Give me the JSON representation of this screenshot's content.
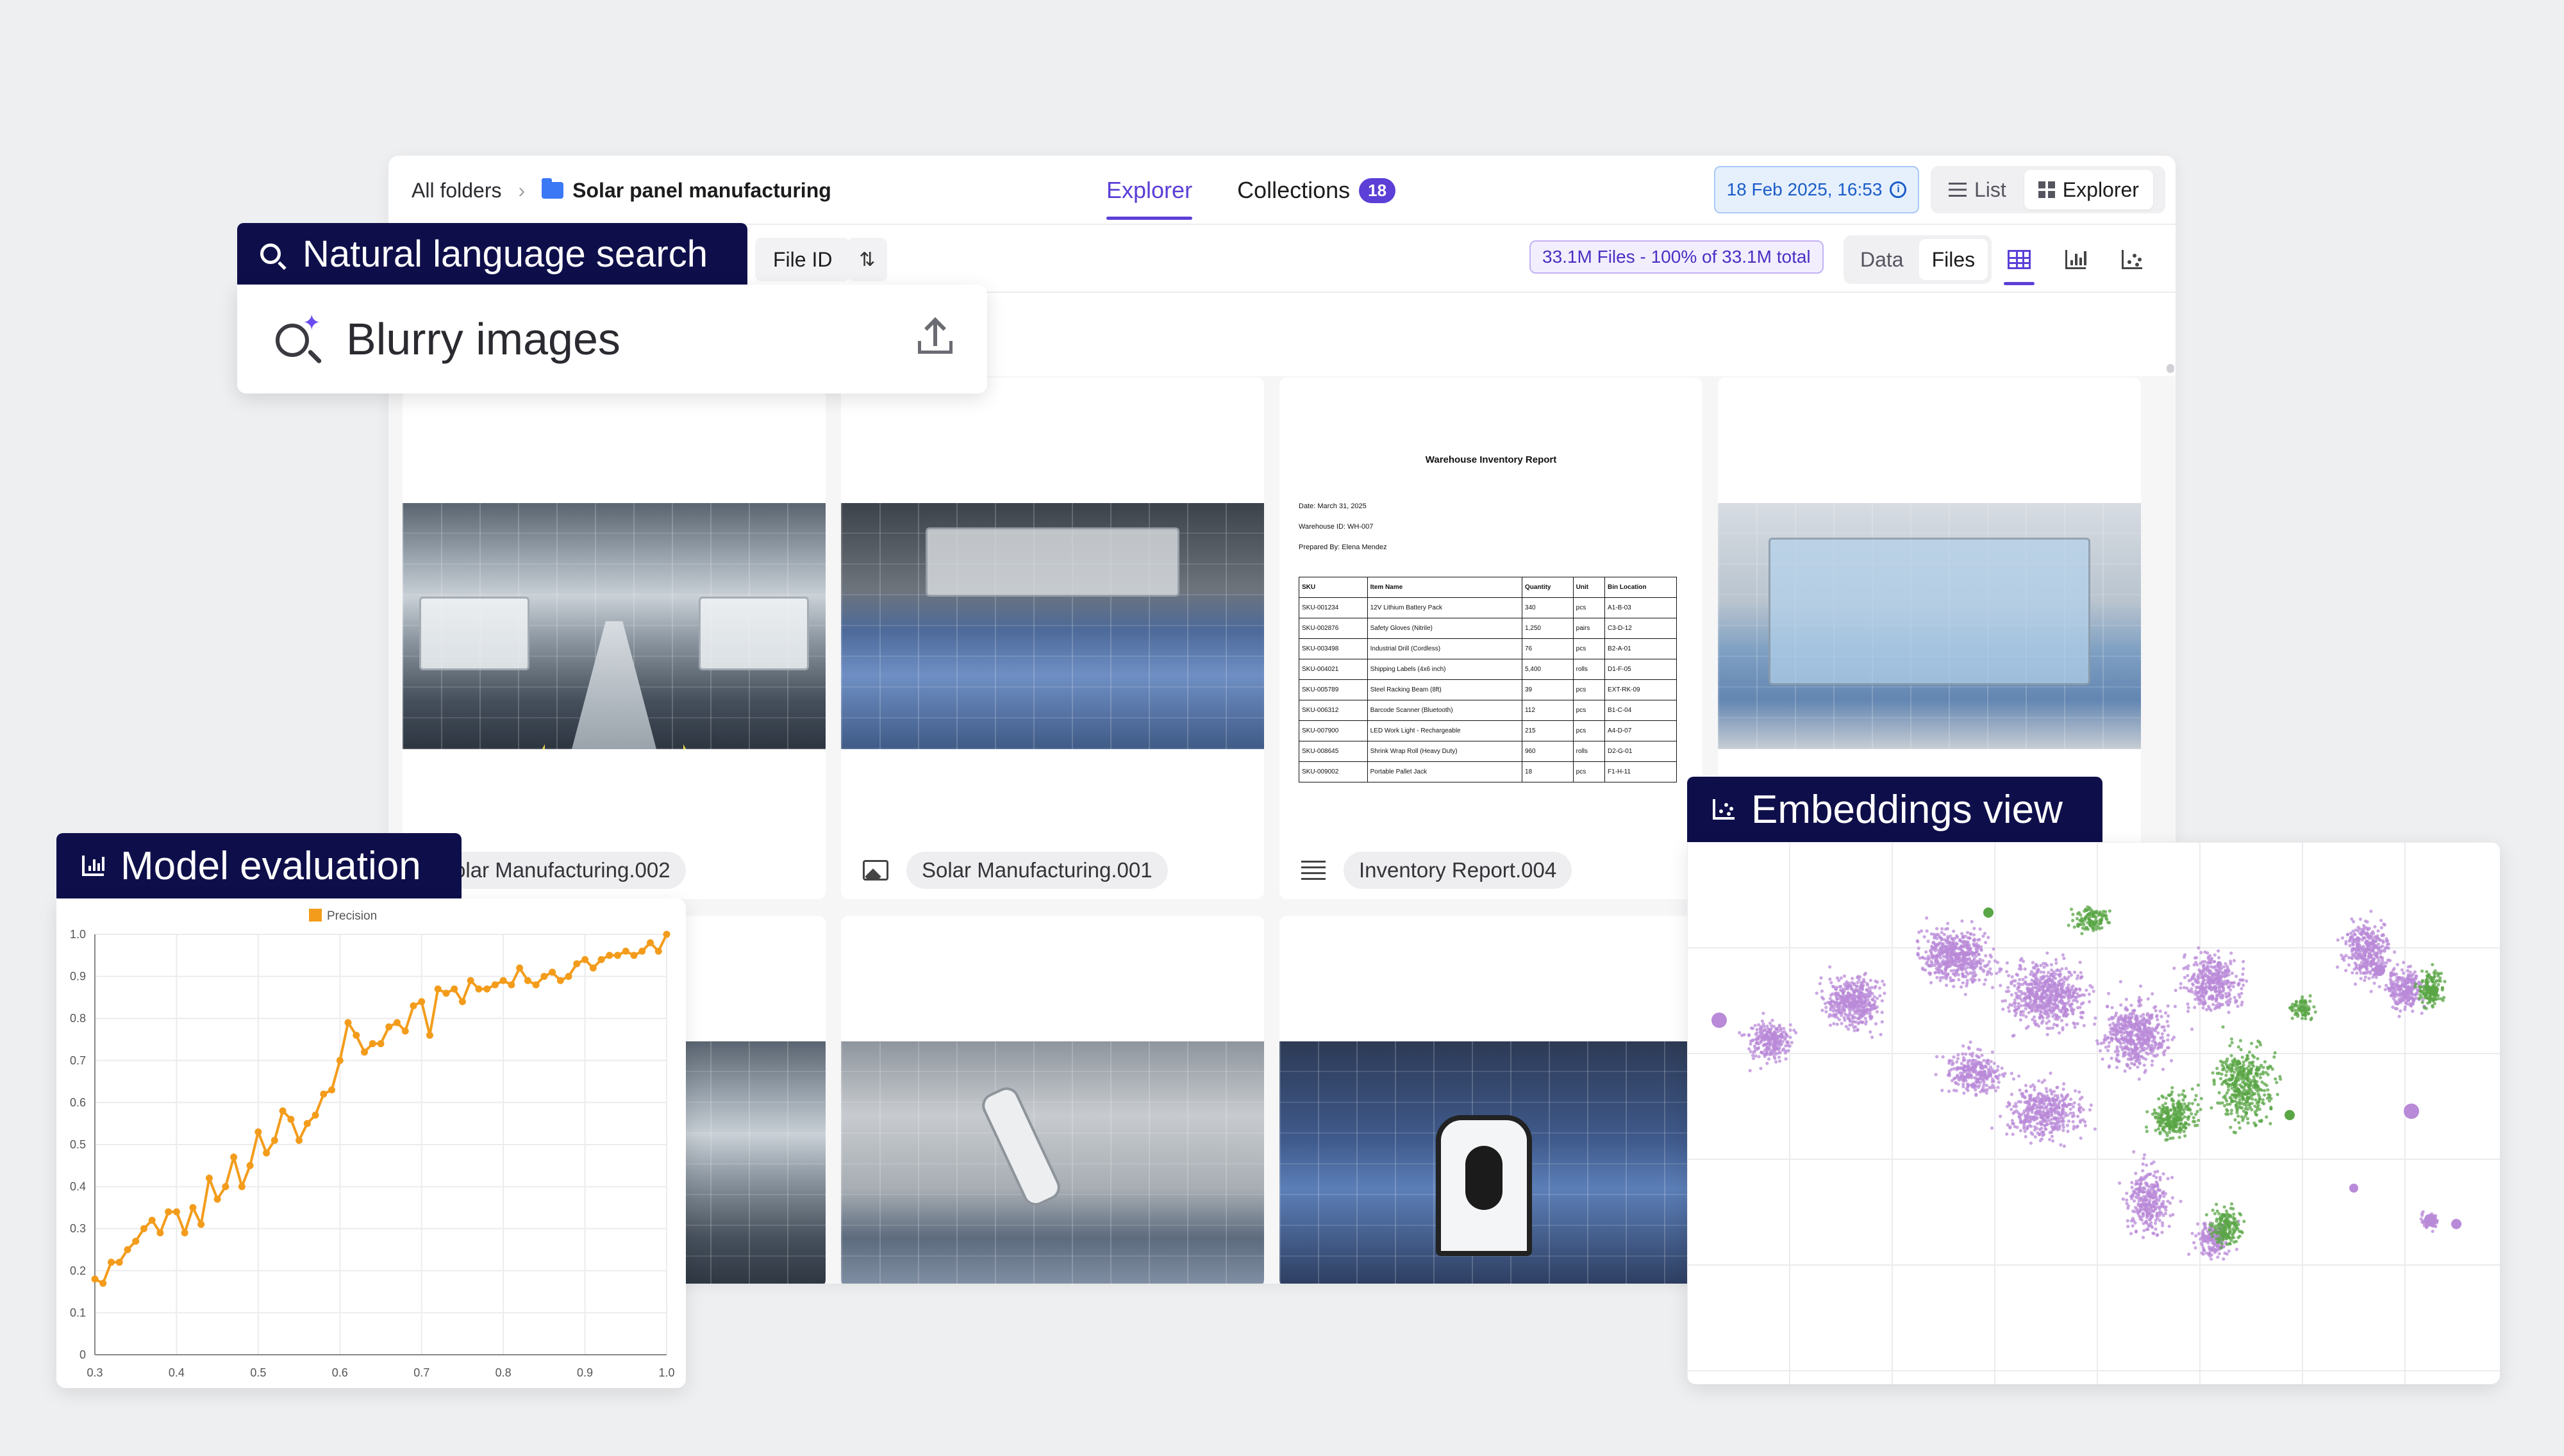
{
  "breadcrumb": {
    "root": "All folders",
    "separator": ">",
    "current": "Solar panel manufacturing"
  },
  "tabs": [
    {
      "label": "Explorer",
      "active": true
    },
    {
      "label": "Collections",
      "badge": "18",
      "active": false
    }
  ],
  "timestamp": "18 Feb 2025, 16:53",
  "view_toggle": {
    "list": "List",
    "explorer": "Explorer",
    "active": "Explorer"
  },
  "toolbar": {
    "file_id": "File ID",
    "files_summary": "33.1M Files - 100% of 33.1M total",
    "data_label": "Data",
    "files_label": "Files",
    "active_mode": "Files"
  },
  "cards": [
    {
      "name": "Solar Manufacturing.002",
      "type": "image"
    },
    {
      "name": "Solar Manufacturing.001",
      "type": "image"
    },
    {
      "name": "Inventory Report.004",
      "type": "document"
    },
    {
      "name": "",
      "type": "image"
    },
    {
      "name": "",
      "type": "image"
    },
    {
      "name": "",
      "type": "image"
    },
    {
      "name": "",
      "type": "image"
    }
  ],
  "inventory_doc": {
    "title": "Warehouse Inventory Report",
    "date": "Date: March 31, 2025",
    "warehouse": "Warehouse ID: WH-007",
    "prepared_by": "Prepared By: Elena Mendez",
    "headers": [
      "SKU",
      "Item Name",
      "Quantity",
      "Unit",
      "Bin Location"
    ],
    "rows": [
      [
        "SKU-001234",
        "12V Lithium Battery Pack",
        "340",
        "pcs",
        "A1-B-03"
      ],
      [
        "SKU-002876",
        "Safety Gloves (Nitrile)",
        "1,250",
        "pairs",
        "C3-D-12"
      ],
      [
        "SKU-003498",
        "Industrial Drill (Cordless)",
        "76",
        "pcs",
        "B2-A-01"
      ],
      [
        "SKU-004021",
        "Shipping Labels (4x6 inch)",
        "5,400",
        "rolls",
        "D1-F-05"
      ],
      [
        "SKU-005789",
        "Steel Racking Beam (8ft)",
        "39",
        "pcs",
        "EXT-RK-09"
      ],
      [
        "SKU-006312",
        "Barcode Scanner (Bluetooth)",
        "112",
        "pcs",
        "B1-C-04"
      ],
      [
        "SKU-007900",
        "LED Work Light - Rechargeable",
        "215",
        "pcs",
        "A4-D-07"
      ],
      [
        "SKU-008645",
        "Shrink Wrap Roll (Heavy Duty)",
        "960",
        "rolls",
        "D2-G-01"
      ],
      [
        "SKU-009002",
        "Portable Pallet Jack",
        "18",
        "pcs",
        "F1-H-11"
      ]
    ]
  },
  "search_panel": {
    "label": "Natural language search",
    "query": "Blurry images"
  },
  "model_evaluation": {
    "label": "Model evaluation"
  },
  "embeddings_view": {
    "label": "Embeddings view"
  },
  "colors": {
    "accent": "#5b3fd6",
    "panel_label_bg": "#0e0f4a",
    "chart_line": "#f39c1c",
    "cluster_purple": "#b98ad8",
    "cluster_green": "#5aa646"
  },
  "chart_data": [
    {
      "type": "line",
      "legend": [
        "Precision"
      ],
      "legend_position": "top-center",
      "grid": true,
      "xlim": [
        0.3,
        1.0
      ],
      "ylim": [
        0,
        1.0
      ],
      "xticks": [
        "0.3",
        "0.4",
        "0.5",
        "0.6",
        "0.7",
        "0.8",
        "0.9",
        "1.0"
      ],
      "yticks": [
        "0",
        "0.1",
        "0.2",
        "0.3",
        "0.4",
        "0.5",
        "0.6",
        "0.7",
        "0.8",
        "0.9",
        "1.0"
      ],
      "series": [
        {
          "name": "Precision",
          "x": [
            0.3,
            0.31,
            0.32,
            0.33,
            0.34,
            0.35,
            0.36,
            0.37,
            0.38,
            0.39,
            0.4,
            0.41,
            0.42,
            0.43,
            0.44,
            0.45,
            0.46,
            0.47,
            0.48,
            0.49,
            0.5,
            0.51,
            0.52,
            0.53,
            0.54,
            0.55,
            0.56,
            0.57,
            0.58,
            0.59,
            0.6,
            0.61,
            0.62,
            0.63,
            0.64,
            0.65,
            0.66,
            0.67,
            0.68,
            0.69,
            0.7,
            0.71,
            0.72,
            0.73,
            0.74,
            0.75,
            0.76,
            0.77,
            0.78,
            0.79,
            0.8,
            0.81,
            0.82,
            0.83,
            0.84,
            0.85,
            0.86,
            0.87,
            0.88,
            0.89,
            0.9,
            0.91,
            0.92,
            0.93,
            0.94,
            0.95,
            0.96,
            0.97,
            0.98,
            0.99,
            1.0
          ],
          "y": [
            0.18,
            0.17,
            0.22,
            0.22,
            0.25,
            0.27,
            0.3,
            0.32,
            0.29,
            0.34,
            0.34,
            0.29,
            0.35,
            0.31,
            0.42,
            0.37,
            0.4,
            0.47,
            0.4,
            0.45,
            0.53,
            0.48,
            0.51,
            0.58,
            0.56,
            0.51,
            0.55,
            0.57,
            0.62,
            0.63,
            0.7,
            0.79,
            0.76,
            0.72,
            0.74,
            0.74,
            0.78,
            0.79,
            0.77,
            0.83,
            0.84,
            0.76,
            0.87,
            0.86,
            0.87,
            0.84,
            0.89,
            0.87,
            0.87,
            0.88,
            0.89,
            0.88,
            0.92,
            0.89,
            0.88,
            0.9,
            0.91,
            0.89,
            0.9,
            0.93,
            0.94,
            0.92,
            0.94,
            0.95,
            0.95,
            0.96,
            0.95,
            0.96,
            0.98,
            0.96,
            1.0
          ]
        }
      ]
    },
    {
      "type": "scatter",
      "grid": true,
      "series": [
        {
          "name": "",
          "color": "#b98ad8"
        },
        {
          "name": "",
          "color": "#5aa646"
        }
      ]
    }
  ]
}
